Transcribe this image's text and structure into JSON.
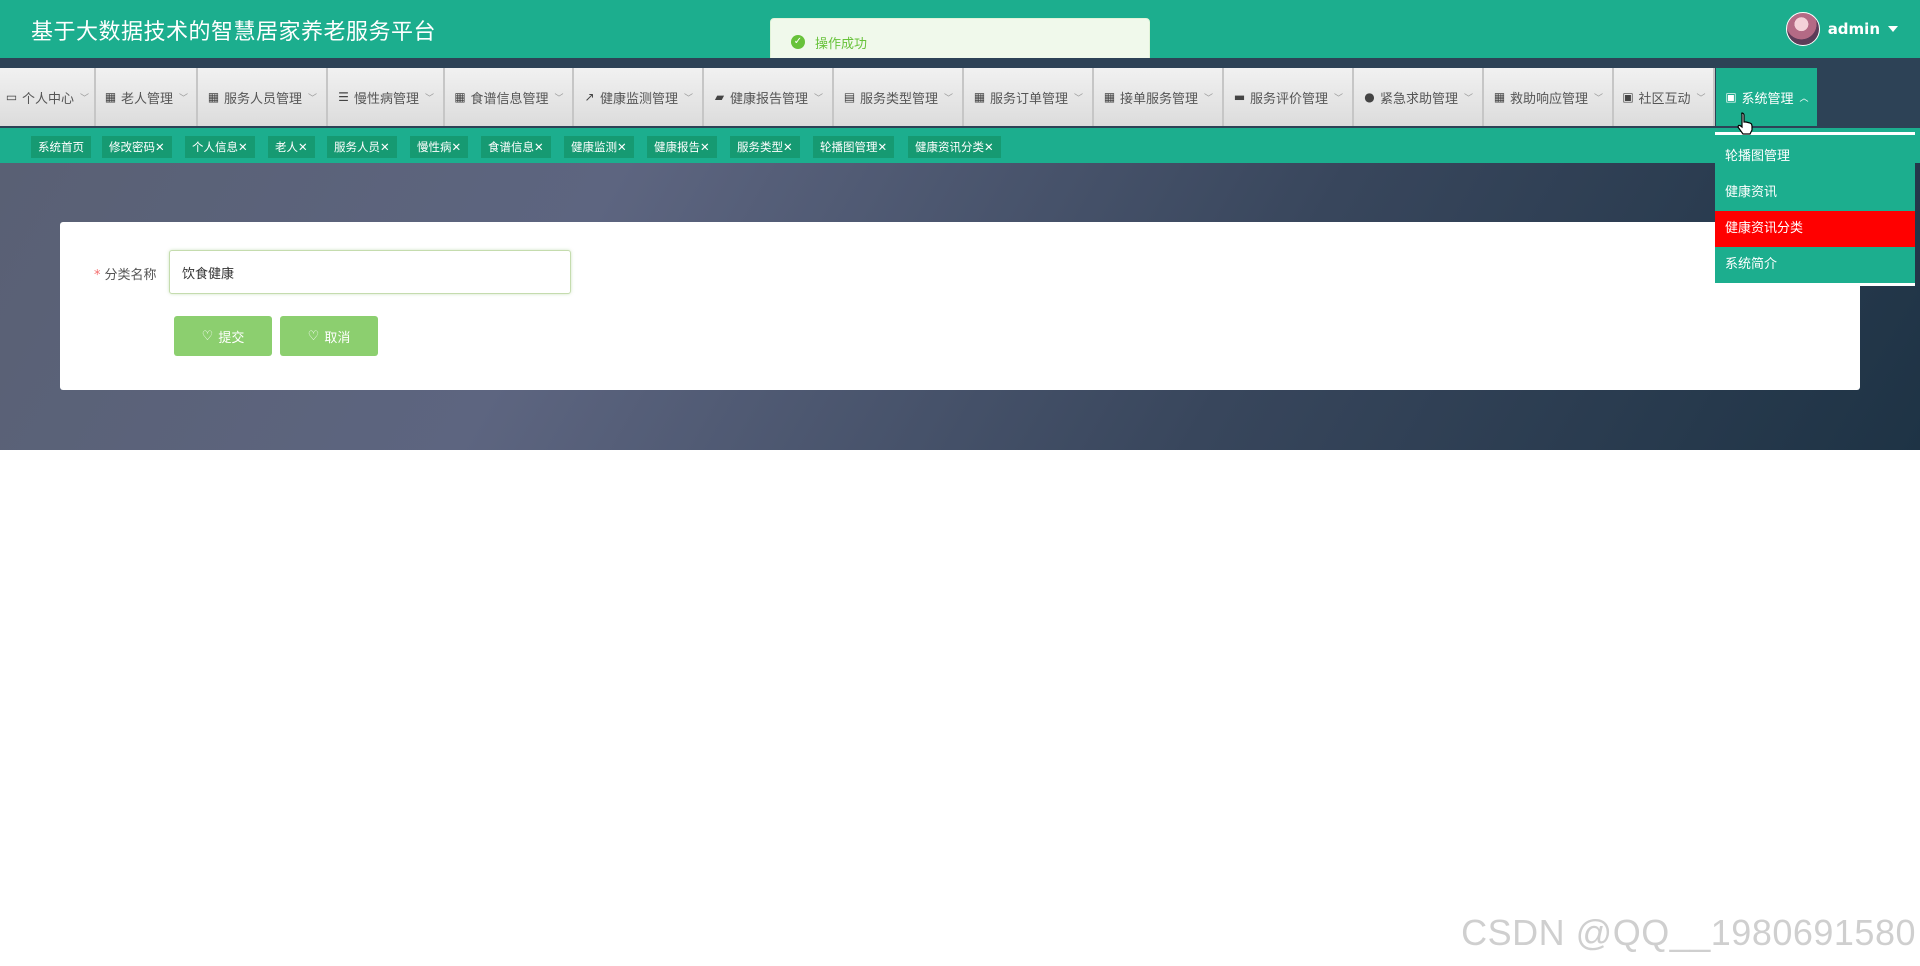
{
  "header": {
    "title": "基于大数据技术的智慧居家养老服务平台",
    "username": "admin"
  },
  "toast": {
    "message": "操作成功"
  },
  "nav": {
    "items": [
      {
        "label": "个人中心",
        "icon": "calendar-icon"
      },
      {
        "label": "老人管理",
        "icon": "grid-icon"
      },
      {
        "label": "服务人员管理",
        "icon": "grid-icon"
      },
      {
        "label": "慢性病管理",
        "icon": "sliders-icon"
      },
      {
        "label": "食谱信息管理",
        "icon": "grid-icon"
      },
      {
        "label": "健康监测管理",
        "icon": "chart-icon"
      },
      {
        "label": "健康报告管理",
        "icon": "wallet-icon"
      },
      {
        "label": "服务类型管理",
        "icon": "clipboard-icon"
      },
      {
        "label": "服务订单管理",
        "icon": "grid-icon"
      },
      {
        "label": "接单服务管理",
        "icon": "grid-icon"
      },
      {
        "label": "服务评价管理",
        "icon": "briefcase-icon"
      },
      {
        "label": "紧急求助管理",
        "icon": "user-icon"
      },
      {
        "label": "救助响应管理",
        "icon": "grid-icon"
      },
      {
        "label": "社区互动",
        "icon": "clipboard-x-icon"
      },
      {
        "label": "系统管理",
        "icon": "clipboard-check-icon"
      }
    ]
  },
  "tags": [
    {
      "label": "系统首页"
    },
    {
      "label": "修改密码✕"
    },
    {
      "label": "个人信息✕"
    },
    {
      "label": "老人✕"
    },
    {
      "label": "服务人员✕"
    },
    {
      "label": "慢性病✕"
    },
    {
      "label": "食谱信息✕"
    },
    {
      "label": "健康监测✕"
    },
    {
      "label": "健康报告✕"
    },
    {
      "label": "服务类型✕"
    },
    {
      "label": "轮播图管理✕"
    },
    {
      "label": "健康资讯分类✕"
    }
  ],
  "dropdown": {
    "items": [
      {
        "label": "轮播图管理"
      },
      {
        "label": "健康资讯"
      },
      {
        "label": "健康资讯分类"
      },
      {
        "label": "系统简介"
      }
    ]
  },
  "form": {
    "label": "分类名称",
    "required_mark": "*",
    "value": "饮食健康",
    "submit_label": "提交",
    "cancel_label": "取消"
  },
  "watermark": "CSDN @QQ__1980691580"
}
